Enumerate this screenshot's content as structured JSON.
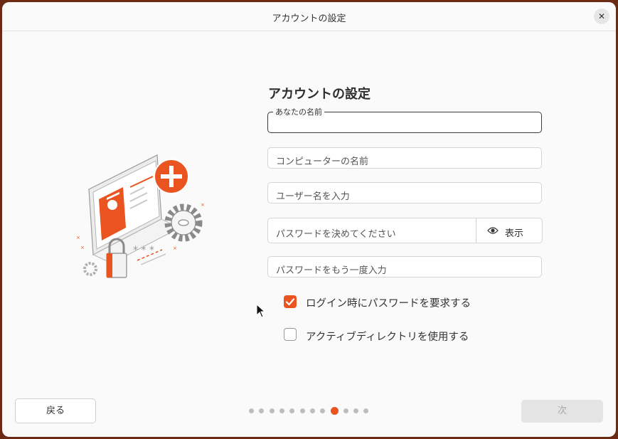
{
  "window": {
    "title": "アカウントの設定",
    "close_glyph": "✕"
  },
  "form": {
    "heading": "アカウントの設定",
    "name_label": "あなたの名前",
    "name_value": "",
    "computer_name_placeholder": "コンピューターの名前",
    "username_placeholder": "ユーザー名を入力",
    "password_placeholder": "パスワードを決めてください",
    "show_password_label": "表示",
    "confirm_password_placeholder": "パスワードをもう一度入力",
    "require_password_label": "ログイン時にパスワードを要求する",
    "require_password_checked": true,
    "active_directory_label": "アクティブディレクトリを使用する",
    "active_directory_checked": false
  },
  "footer": {
    "back_label": "戻る",
    "next_label": "次",
    "next_enabled": false,
    "page_dots": {
      "total": 12,
      "current": 9
    }
  },
  "icons": [
    "close-icon",
    "eye-icon",
    "checkmark-icon",
    "account-illustration",
    "mouse-cursor-icon"
  ],
  "colors": {
    "accent": "#e95420",
    "disabled": "#e4e4e4",
    "background": "#fafafa"
  }
}
